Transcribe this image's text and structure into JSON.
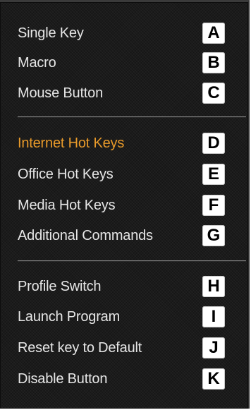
{
  "menu": {
    "groups": [
      {
        "items": [
          {
            "label": "Single Key",
            "shortcut": "A"
          },
          {
            "label": "Macro",
            "shortcut": "B"
          },
          {
            "label": "Mouse Button",
            "shortcut": "C"
          }
        ]
      },
      {
        "items": [
          {
            "label": "Internet Hot Keys",
            "shortcut": "D",
            "highlighted": true
          },
          {
            "label": "Office Hot Keys",
            "shortcut": "E"
          },
          {
            "label": "Media Hot Keys",
            "shortcut": "F"
          },
          {
            "label": "Additional Commands",
            "shortcut": "G"
          }
        ]
      },
      {
        "items": [
          {
            "label": "Profile Switch",
            "shortcut": "H"
          },
          {
            "label": "Launch Program",
            "shortcut": "I"
          },
          {
            "label": "Reset key to Default",
            "shortcut": "J"
          },
          {
            "label": "Disable Button",
            "shortcut": "K"
          }
        ]
      }
    ]
  },
  "colors": {
    "background": "#1b1b1b",
    "text": "#e6e6e6",
    "highlight": "#e89a2a",
    "shortcut_badge": "#ffffff",
    "divider": "#8a8a8a"
  }
}
